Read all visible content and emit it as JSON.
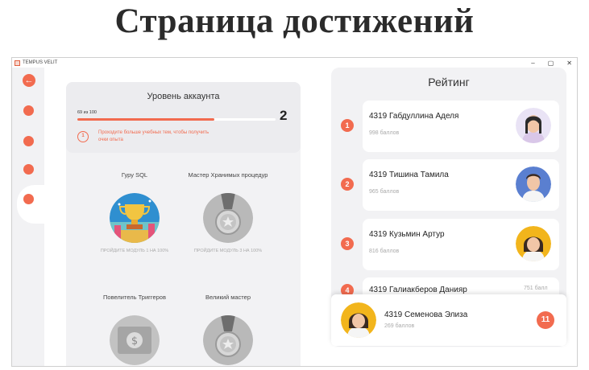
{
  "page_heading": "Страница достижений",
  "window": {
    "title": "TEMPUS VELIT",
    "controls": [
      "–",
      "▢",
      "✕"
    ]
  },
  "nav": {
    "back_icon": "arrow-left-icon",
    "items": [
      "nav-item-1",
      "nav-item-2",
      "nav-item-3",
      "nav-item-4"
    ]
  },
  "account": {
    "title": "Уровень аккаунта",
    "progress_text": "69 из 100",
    "progress_fraction": 0.69,
    "level": "2",
    "hint_icon_label": "1",
    "hint": "Проходите больше учебных тем, чтобы получить очки опыта"
  },
  "badges": [
    {
      "title": "Гуру SQL",
      "note": "ПРОЙДИТЕ МОДУЛЬ 1 НА 100%",
      "icon": "trophy-icon"
    },
    {
      "title": "Мастер Хранимых процедур",
      "note": "ПРОЙДИТЕ МОДУЛЬ 3 НА 100%",
      "icon": "medal-icon"
    },
    {
      "title": "Повелитель Триггеров",
      "note": "",
      "icon": "money-icon"
    },
    {
      "title": "Великий мастер",
      "note": "",
      "icon": "medal-icon"
    }
  ],
  "rating": {
    "title": "Рейтинг",
    "entries": [
      {
        "rank": "1",
        "name": "4319 Габдуллина Аделя",
        "score": "998 баллов"
      },
      {
        "rank": "2",
        "name": "4319 Тишина Тамила",
        "score": "965 баллов"
      },
      {
        "rank": "3",
        "name": "4319 Кузьмин Артур",
        "score": "816 баллов"
      },
      {
        "rank": "4",
        "name": "4319 Галиакберов Данияр",
        "score": "751 балл"
      }
    ],
    "me": {
      "rank": "11",
      "name": "4319 Семенова  Элиза",
      "score": "269 баллов"
    }
  },
  "colors": {
    "accent": "#f26b4f",
    "panel": "#f2f2f4",
    "text": "#222222",
    "muted": "#aaaaaa"
  }
}
